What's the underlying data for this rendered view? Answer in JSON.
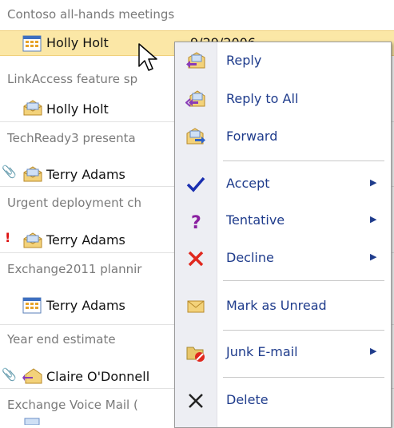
{
  "messages": [
    {
      "subject": "Contoso all-hands meetings",
      "sender": "Holly Holt",
      "date": "9/29/2006",
      "icon": "calendar-icon",
      "selected": true
    },
    {
      "subject": "LinkAccess feature sp",
      "sender": "Holly Holt",
      "icon": "envelope-open-icon"
    },
    {
      "subject": "TechReady3 presenta",
      "sender": "Terry Adams",
      "icon": "envelope-open-icon",
      "attachment": true
    },
    {
      "subject": "Urgent deployment ch",
      "sender": "Terry Adams",
      "icon": "envelope-open-icon",
      "important": true
    },
    {
      "subject": "Exchange2011 plannir",
      "sender": "Terry Adams",
      "icon": "calendar-icon"
    },
    {
      "subject": "Year end estimate",
      "sender": "Claire O'Donnell",
      "icon": "reply-envelope-icon",
      "attachment": true
    },
    {
      "subject": "Exchange Voice Mail (",
      "sender": "",
      "icon": "voicemail-icon"
    }
  ],
  "menu": {
    "items": [
      {
        "label": "Reply",
        "icon": "reply-icon",
        "submenu": false
      },
      {
        "label": "Reply to All",
        "icon": "reply-all-icon",
        "submenu": false
      },
      {
        "label": "Forward",
        "icon": "forward-icon",
        "submenu": false
      },
      {
        "label": "Accept",
        "icon": "accept-check-icon",
        "submenu": true
      },
      {
        "label": "Tentative",
        "icon": "tentative-question-icon",
        "submenu": true
      },
      {
        "label": "Decline",
        "icon": "decline-x-icon",
        "submenu": true
      },
      {
        "label": "Mark as Unread",
        "icon": "unread-envelope-icon",
        "submenu": false
      },
      {
        "label": "Junk E-mail",
        "icon": "junk-mail-icon",
        "submenu": true
      },
      {
        "label": "Delete",
        "icon": "delete-x-icon",
        "submenu": false
      }
    ]
  },
  "colors": {
    "selected_row": "#fbe7a6",
    "menu_text": "#1f3c8c",
    "accent_check": "#1a2fb0",
    "tentative": "#8a1fa0",
    "decline": "#e0281e"
  }
}
